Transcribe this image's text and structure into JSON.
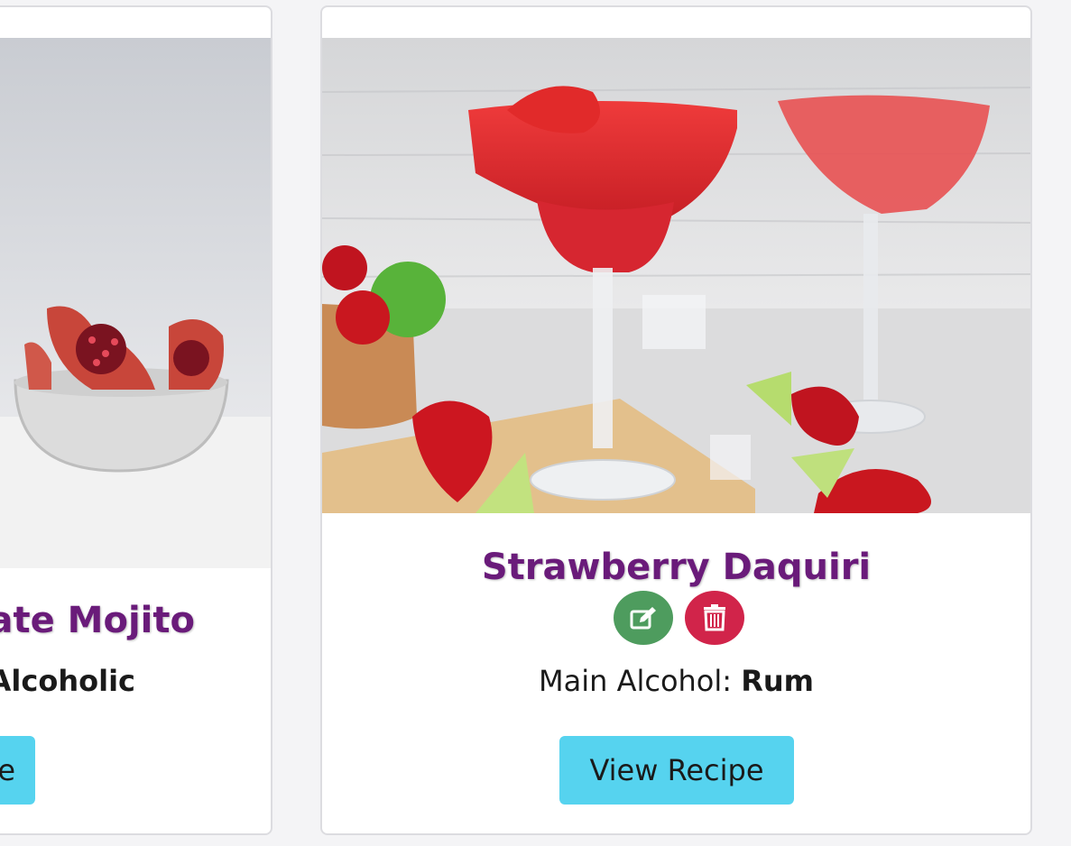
{
  "cards": [
    {
      "title": "ate Mojito",
      "alcohol_label": "",
      "alcohol_value": "Alcoholic",
      "button_label": "e"
    },
    {
      "title": "Strawberry Daquiri",
      "alcohol_label": "Main Alcohol: ",
      "alcohol_value": "Rum",
      "button_label": "View Recipe",
      "actions": [
        {
          "icon": "edit-icon",
          "color": "#4e9c5e"
        },
        {
          "icon": "trash-icon",
          "color": "#d1244a"
        }
      ]
    }
  ],
  "colors": {
    "title": "#6a1b7a",
    "button": "#56d3ef",
    "page_bg": "#f4f4f6"
  }
}
